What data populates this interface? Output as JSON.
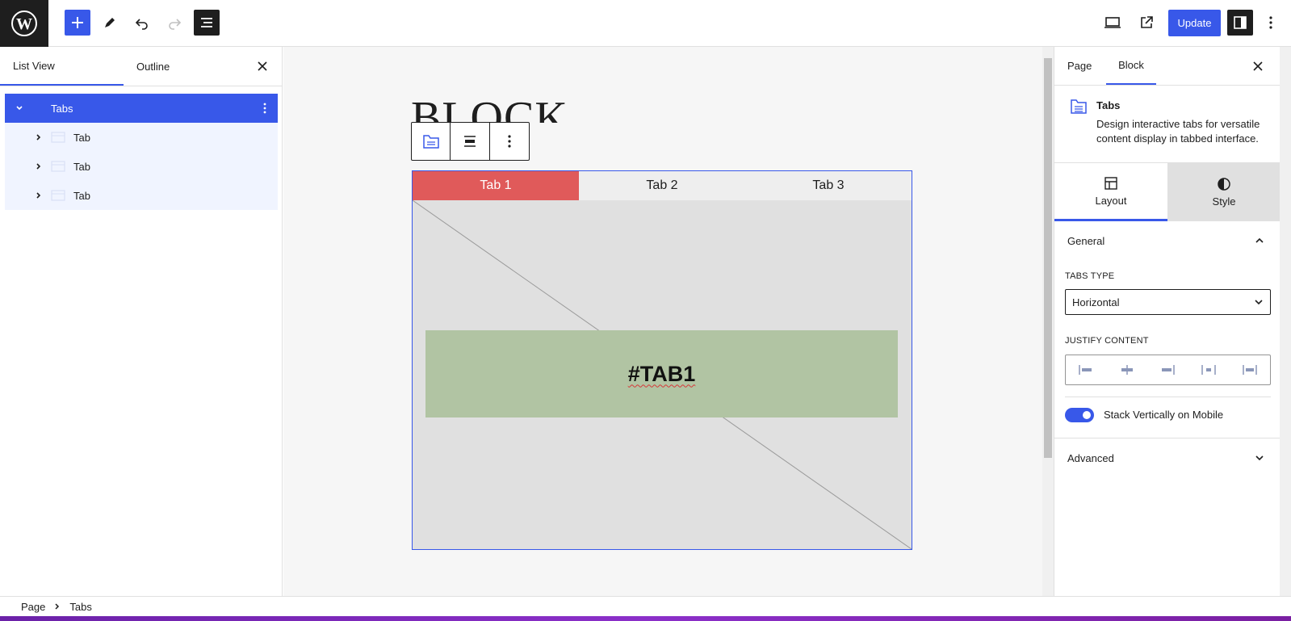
{
  "topbar": {
    "update_label": "Update"
  },
  "left_panel": {
    "tabs": [
      {
        "label": "List View"
      },
      {
        "label": "Outline"
      }
    ],
    "items": [
      {
        "label": "Tabs"
      },
      {
        "label": "Tab"
      },
      {
        "label": "Tab"
      },
      {
        "label": "Tab"
      }
    ]
  },
  "canvas": {
    "title": "BLOCK",
    "tabs": [
      {
        "label": "Tab 1"
      },
      {
        "label": "Tab 2"
      },
      {
        "label": "Tab 3"
      }
    ],
    "content_text": "#TAB1",
    "active_tab_color": "#e05a5a",
    "content_bg": "#b1c4a3"
  },
  "right_panel": {
    "tabs": [
      {
        "label": "Page"
      },
      {
        "label": "Block"
      }
    ],
    "block": {
      "title": "Tabs",
      "description": "Design interactive tabs for versatile content display in tabbed interface."
    },
    "subtabs": [
      {
        "label": "Layout"
      },
      {
        "label": "Style"
      }
    ],
    "general": {
      "title": "General",
      "tabs_type_label": "Tabs Type",
      "tabs_type_value": "Horizontal",
      "justify_label": "Justify Content",
      "toggle_label": "Stack Vertically on Mobile"
    },
    "advanced": {
      "title": "Advanced"
    }
  },
  "footer": {
    "breadcrumbs": [
      "Page",
      "Tabs"
    ]
  },
  "colors": {
    "accent": "#3858e9",
    "dark": "#1e1e1e"
  }
}
